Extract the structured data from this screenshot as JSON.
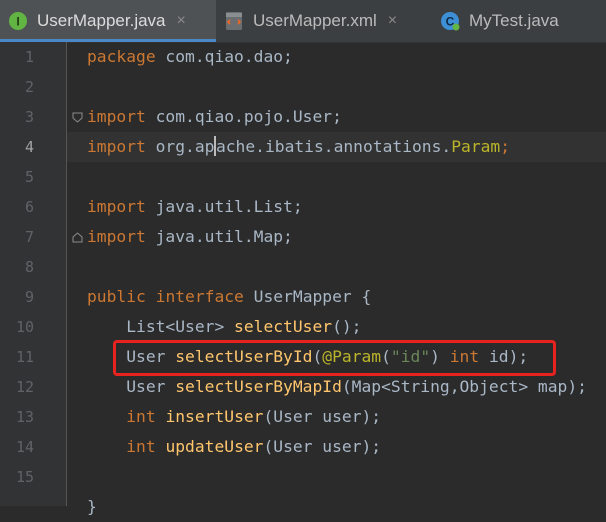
{
  "tabs": [
    {
      "label": "UserMapper.java",
      "icon": "interface-icon",
      "close": "×",
      "active": true
    },
    {
      "label": "UserMapper.xml",
      "icon": "xml-file-icon",
      "close": "×",
      "active": false
    },
    {
      "label": "MyTest.java",
      "icon": "class-icon",
      "active": false
    }
  ],
  "tab_icon_letters": {
    "interface": "I",
    "class": "C"
  },
  "line_numbers": [
    "1",
    "2",
    "3",
    "4",
    "5",
    "6",
    "7",
    "8",
    "9",
    "10",
    "11",
    "12",
    "13",
    "14",
    "15"
  ],
  "current_line": "4",
  "code": {
    "l1": {
      "package_kw": "package",
      "rest": " com.qiao.dao;"
    },
    "l3": {
      "import_kw": "import",
      "rest": " com.qiao.pojo.User;"
    },
    "l4": {
      "import_kw": "import",
      "rest_before_caret": " org.ap",
      "rest_after_caret": "ache.ibatis.annotations.",
      "param_cls": "Param",
      "end": ";"
    },
    "l6": {
      "import_kw": "import",
      "rest": " java.util.List;"
    },
    "l7": {
      "import_kw": "import",
      "rest": " java.util.Map;"
    },
    "l9": {
      "public_kw": "public",
      "interface_kw": "interface",
      "rest": " UserMapper {"
    },
    "l10": {
      "indent": "    ",
      "type": "List<User> ",
      "method": "selectUser",
      "end": "();"
    },
    "l11": {
      "indent": "    ",
      "type": "User ",
      "method": "selectUserById",
      "open": "(",
      "annotation": "@Param",
      "p_open": "(",
      "str": "\"id\"",
      "p_close": ") ",
      "int_kw": "int",
      "end": " id);"
    },
    "l12": {
      "indent": "    ",
      "type": "User ",
      "method": "selectUserByMapId",
      "end": "(Map<String,Object> map);"
    },
    "l13": {
      "indent": "    ",
      "int_kw": "int",
      "method": "insertUser",
      "end": "(User user);"
    },
    "l14": {
      "indent": "    ",
      "int_kw": "int",
      "method": "updateUser",
      "end": "(User user);"
    },
    "l16": {
      "brace": "}"
    }
  },
  "colors": {
    "keyword": "#cc7832",
    "method": "#ffc66d",
    "annotation": "#bbb529",
    "string": "#6a8759",
    "text": "#a9b7c6",
    "highlight_box": "#e8231f"
  }
}
